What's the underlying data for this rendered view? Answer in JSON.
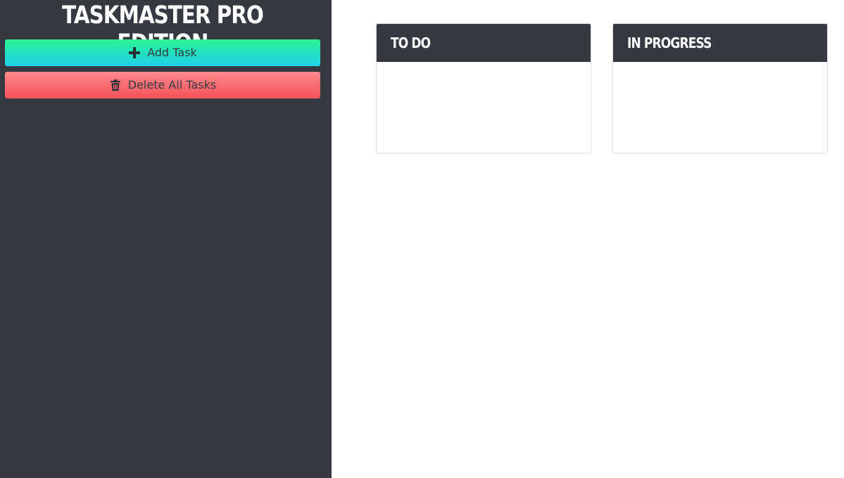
{
  "app": {
    "title": "TASKMASTER PRO EDITION"
  },
  "sidebar": {
    "add_button": {
      "label": "Add Task",
      "icon": "plus-icon"
    },
    "delete_button": {
      "label": "Delete All Tasks",
      "icon": "trash-icon"
    }
  },
  "board": {
    "columns": [
      {
        "title": "TO DO",
        "tasks": []
      },
      {
        "title": "IN PROGRESS",
        "tasks": []
      }
    ]
  },
  "colors": {
    "sidebar_bg": "#353a42",
    "add_gradient_top": "#2cf595",
    "add_gradient_bottom": "#21d3e8",
    "delete_gradient_top": "#ff8a8e",
    "delete_gradient_bottom": "#f45359"
  }
}
